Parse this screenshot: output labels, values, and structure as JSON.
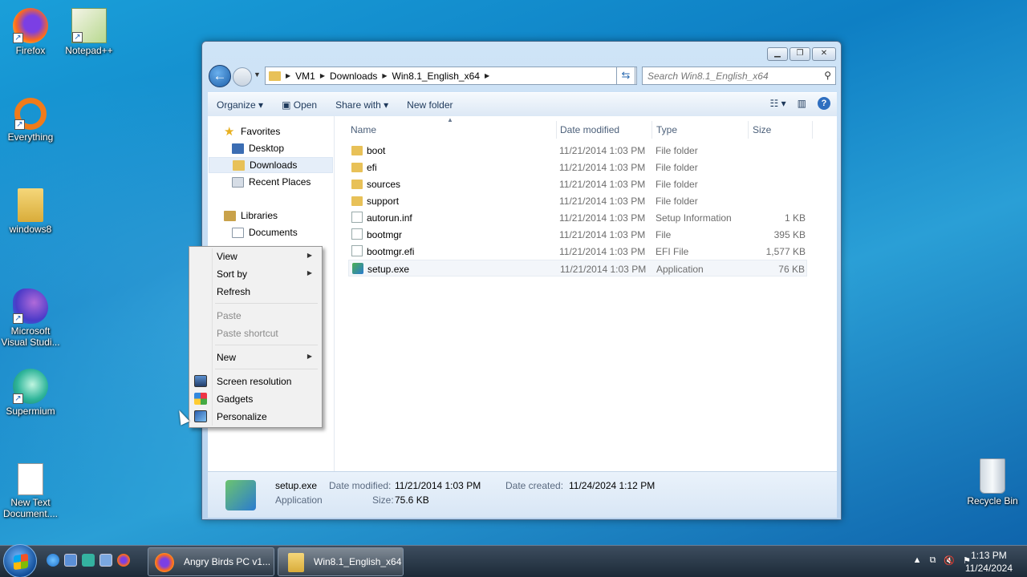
{
  "desktop": {
    "icons": [
      {
        "label": "Firefox"
      },
      {
        "label": "Notepad++"
      },
      {
        "label": "Everything"
      },
      {
        "label": "windows8"
      },
      {
        "label_line1": "Microsoft",
        "label_line2": "Visual Studi..."
      },
      {
        "label": "Supermium"
      },
      {
        "label_line1": "New Text",
        "label_line2": "Document...."
      },
      {
        "label": "Recycle Bin"
      }
    ]
  },
  "explorer": {
    "breadcrumb": [
      "VM1",
      "Downloads",
      "Win8.1_English_x64"
    ],
    "search_placeholder": "Search Win8.1_English_x64",
    "toolbar": {
      "organize": "Organize",
      "open": "Open",
      "share_with": "Share with",
      "new_folder": "New folder"
    },
    "nav": {
      "favorites": "Favorites",
      "desktop": "Desktop",
      "downloads": "Downloads",
      "recent_places": "Recent Places",
      "libraries": "Libraries",
      "documents": "Documents"
    },
    "columns": {
      "name": "Name",
      "date": "Date modified",
      "type": "Type",
      "size": "Size"
    },
    "files": [
      {
        "name": "boot",
        "date": "11/21/2014 1:03 PM",
        "type": "File folder",
        "size": "",
        "icon": "folder-icon"
      },
      {
        "name": "efi",
        "date": "11/21/2014 1:03 PM",
        "type": "File folder",
        "size": "",
        "icon": "folder-icon"
      },
      {
        "name": "sources",
        "date": "11/21/2014 1:03 PM",
        "type": "File folder",
        "size": "",
        "icon": "folder-icon"
      },
      {
        "name": "support",
        "date": "11/21/2014 1:03 PM",
        "type": "File folder",
        "size": "",
        "icon": "folder-icon"
      },
      {
        "name": "autorun.inf",
        "date": "11/21/2014 1:03 PM",
        "type": "Setup Information",
        "size": "1 KB",
        "icon": "setup-info-icon"
      },
      {
        "name": "bootmgr",
        "date": "11/21/2014 1:03 PM",
        "type": "File",
        "size": "395 KB",
        "icon": "file-icon"
      },
      {
        "name": "bootmgr.efi",
        "date": "11/21/2014 1:03 PM",
        "type": "EFI File",
        "size": "1,577 KB",
        "icon": "file-icon"
      },
      {
        "name": "setup.exe",
        "date": "11/21/2014 1:03 PM",
        "type": "Application",
        "size": "76 KB",
        "icon": "setup-exe-icon"
      }
    ],
    "details": {
      "name": "setup.exe",
      "kind": "Application",
      "date_modified_label": "Date modified:",
      "date_modified": "11/21/2014 1:03 PM",
      "date_created_label": "Date created:",
      "date_created": "11/24/2024 1:12 PM",
      "size_label": "Size:",
      "size": "75.6 KB"
    }
  },
  "context_menu": {
    "view": "View",
    "sort_by": "Sort by",
    "refresh": "Refresh",
    "paste": "Paste",
    "paste_shortcut": "Paste shortcut",
    "new": "New",
    "screen_resolution": "Screen resolution",
    "gadgets": "Gadgets",
    "personalize": "Personalize"
  },
  "taskbar": {
    "tasks": [
      {
        "label": "Angry Birds PC v1..."
      },
      {
        "label": "Win8.1_English_x64"
      }
    ],
    "time": "1:13 PM",
    "date": "11/24/2024"
  }
}
